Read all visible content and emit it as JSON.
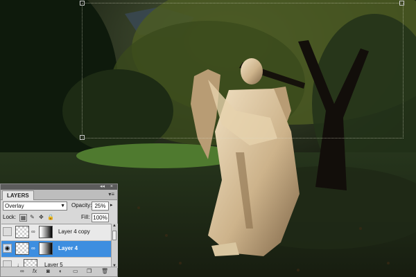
{
  "layers_panel": {
    "tab_label": "LAYERS",
    "blend_mode": "Overlay",
    "opacity_label": "Opacity:",
    "opacity_value": "25%",
    "lock_label": "Lock:",
    "fill_label": "Fill:",
    "fill_value": "100%",
    "layers": [
      {
        "name": "Layer 4 copy",
        "visible": false,
        "selected": false,
        "has_mask": true
      },
      {
        "name": "Layer 4",
        "visible": true,
        "selected": true,
        "has_mask": true
      },
      {
        "name": "Layer 5",
        "visible": false,
        "selected": false,
        "has_mask": false
      }
    ]
  },
  "colors": {
    "selection": "#3d8ee0",
    "panel_bg": "#d8d8d8"
  }
}
